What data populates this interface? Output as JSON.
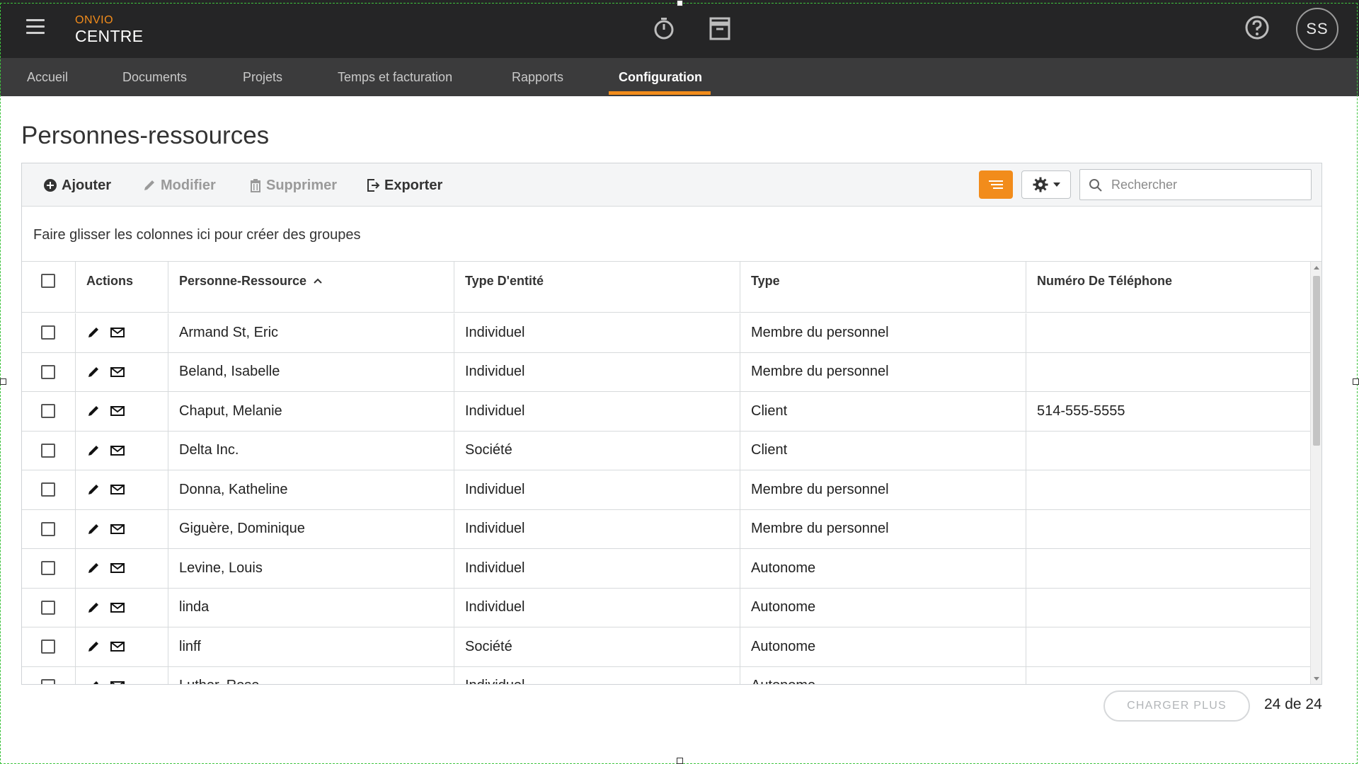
{
  "app": {
    "brand_top": "ONVIO",
    "brand_bottom": "CENTRE",
    "avatar_initials": "SS",
    "icons": [
      "menu-icon",
      "timer-icon",
      "archive-icon",
      "help-icon"
    ]
  },
  "nav": {
    "items": [
      {
        "label": "Accueil"
      },
      {
        "label": "Documents"
      },
      {
        "label": "Projets"
      },
      {
        "label": "Temps et facturation"
      },
      {
        "label": "Rapports"
      },
      {
        "label": "Configuration"
      }
    ],
    "active": "Configuration"
  },
  "page": {
    "title": "Personnes-ressources"
  },
  "toolbar": {
    "add_label": "Ajouter",
    "edit_label": "Modifier",
    "delete_label": "Supprimer",
    "export_label": "Exporter",
    "search_placeholder": "Rechercher",
    "search_value": ""
  },
  "grid": {
    "group_hint": "Faire glisser les colonnes ici pour créer des groupes",
    "columns": {
      "actions": "Actions",
      "contact": "Personne-Ressource",
      "entity_type": "Type D'entité",
      "type": "Type",
      "phone": "Numéro De Téléphone"
    },
    "sort": {
      "column": "Personne-Ressource",
      "direction": "ascending"
    },
    "rows": [
      {
        "contact": "Armand St, Eric",
        "entity_type": "Individuel",
        "type": "Membre du personnel",
        "phone": ""
      },
      {
        "contact": "Beland, Isabelle",
        "entity_type": "Individuel",
        "type": "Membre du personnel",
        "phone": ""
      },
      {
        "contact": "Chaput, Melanie",
        "entity_type": "Individuel",
        "type": "Client",
        "phone": "514-555-5555"
      },
      {
        "contact": "Delta Inc.",
        "entity_type": "Société",
        "type": "Client",
        "phone": ""
      },
      {
        "contact": "Donna, Katheline",
        "entity_type": "Individuel",
        "type": "Membre du personnel",
        "phone": ""
      },
      {
        "contact": "Giguère, Dominique",
        "entity_type": "Individuel",
        "type": "Membre du personnel",
        "phone": ""
      },
      {
        "contact": "Levine, Louis",
        "entity_type": "Individuel",
        "type": "Autonome",
        "phone": ""
      },
      {
        "contact": "linda",
        "entity_type": "Individuel",
        "type": "Autonome",
        "phone": ""
      },
      {
        "contact": "linff",
        "entity_type": "Société",
        "type": "Autonome",
        "phone": ""
      },
      {
        "contact": "Luther, Rose",
        "entity_type": "Individuel",
        "type": "Autonome",
        "phone": ""
      }
    ]
  },
  "footer": {
    "load_more_label": "CHARGER PLUS",
    "count_text": "24 de 24"
  },
  "colors": {
    "accent": "#f28c1b",
    "topbar": "#252526",
    "navbar": "#3b3b3c"
  }
}
